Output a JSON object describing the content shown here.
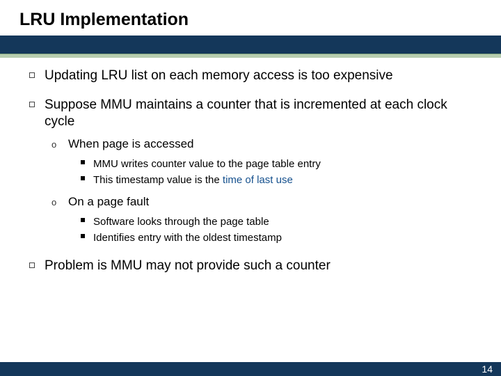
{
  "slide": {
    "title": "LRU Implementation",
    "page_number": "14",
    "bullets": [
      {
        "text": "Updating LRU list on each memory access is too expensive",
        "children": []
      },
      {
        "text": "Suppose MMU maintains a counter that is incremented at each clock cycle",
        "children": [
          {
            "text": "When page is accessed",
            "children": [
              {
                "text": "MMU writes counter value to the page table entry"
              },
              {
                "prefix": "This timestamp value is the ",
                "highlight": "time of last use"
              }
            ]
          },
          {
            "text": "On a page fault",
            "children": [
              {
                "text": "Software looks through the page table"
              },
              {
                "text": "Identifies entry with the oldest timestamp"
              }
            ]
          }
        ]
      },
      {
        "text": "Problem is MMU may not provide such a counter",
        "children": []
      }
    ]
  }
}
